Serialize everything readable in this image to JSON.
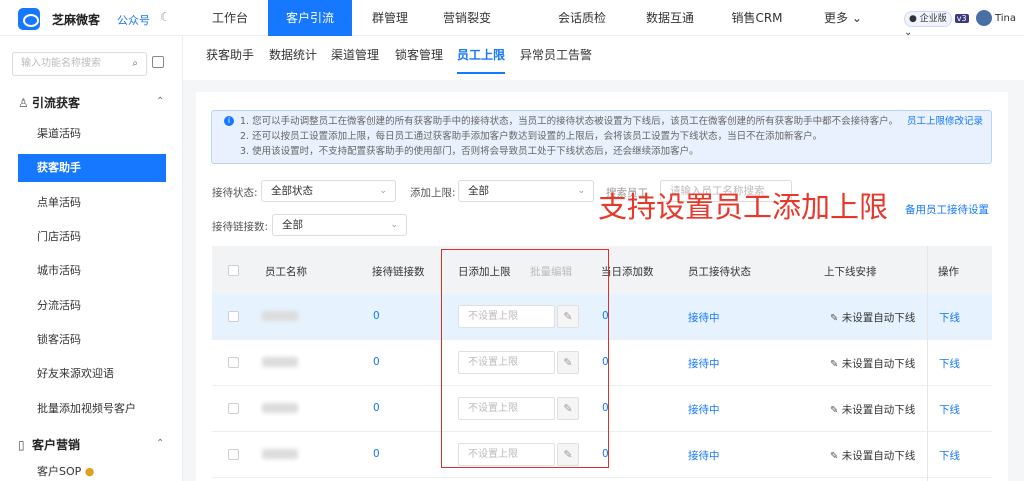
{
  "header": {
    "brand": "芝麻微客",
    "gzh": "公众号",
    "nav": [
      "工作台",
      "客户引流",
      "群管理",
      "营销裂变",
      "会话质检",
      "数据互通",
      "销售CRM",
      "更多"
    ],
    "active_nav": "客户引流",
    "enterprise": "企业版",
    "version": "v3",
    "user": "Tina"
  },
  "sidebar": {
    "search_placeholder": "输入功能名称搜索",
    "section1": "引流获客",
    "items": [
      "渠道活码",
      "获客助手",
      "点单活码",
      "门店活码",
      "城市活码",
      "分流活码",
      "锁客活码",
      "好友来源欢迎语",
      "批量添加视频号客户"
    ],
    "active_item": "获客助手",
    "section2": "客户营销",
    "item_last": "客户SOP"
  },
  "tabs": [
    "获客助手",
    "数据统计",
    "渠道管理",
    "锁客管理",
    "员工上限",
    "异常员工告警"
  ],
  "active_tab": "员工上限",
  "notice": {
    "lines": [
      "1. 您可以手动调整员工在微客创建的所有获客助手中的接待状态，当员工的接待状态被设置为下线后，该员工在微客创建的所有获客助手中都不会接待客户。",
      "2. 还可以按员工设置添加上限，每日员工通过获客助手添加客户数达到设置的上限后，会将该员工设置为下线状态，当日不在添加新客户。",
      "3. 使用该设置时，不支持配置获客助手的使用部门，否则将会导致员工处于下线状态后，还会继续添加客户。"
    ],
    "link": "员工上限修改记录"
  },
  "filters": {
    "status_label": "接待状态:",
    "status_value": "全部状态",
    "limit_label": "添加上限:",
    "limit_value": "全部",
    "links_label": "接待链接数:",
    "links_value": "全部",
    "search_label": "搜索员工",
    "search_placeholder": "请输入员工名称搜索"
  },
  "overlay": "支持设置员工添加上限",
  "setting_link": "备用员工接待设置",
  "table": {
    "headers": [
      "员工名称",
      "接待链接数",
      "日添加上限",
      "批量编辑",
      "当日添加数",
      "员工接待状态",
      "上下线安排",
      "操作"
    ],
    "rows": [
      {
        "links": "0",
        "limit_placeholder": "不设置上限",
        "today": "0",
        "status": "接待中",
        "schedule": "未设置自动下线",
        "action": "下线"
      },
      {
        "links": "0",
        "limit_placeholder": "不设置上限",
        "today": "0",
        "status": "接待中",
        "schedule": "未设置自动下线",
        "action": "下线"
      },
      {
        "links": "0",
        "limit_placeholder": "不设置上限",
        "today": "0",
        "status": "接待中",
        "schedule": "未设置自动下线",
        "action": "下线"
      },
      {
        "links": "0",
        "limit_placeholder": "不设置上限",
        "today": "0",
        "status": "接待中",
        "schedule": "未设置自动下线",
        "action": "下线"
      }
    ]
  }
}
